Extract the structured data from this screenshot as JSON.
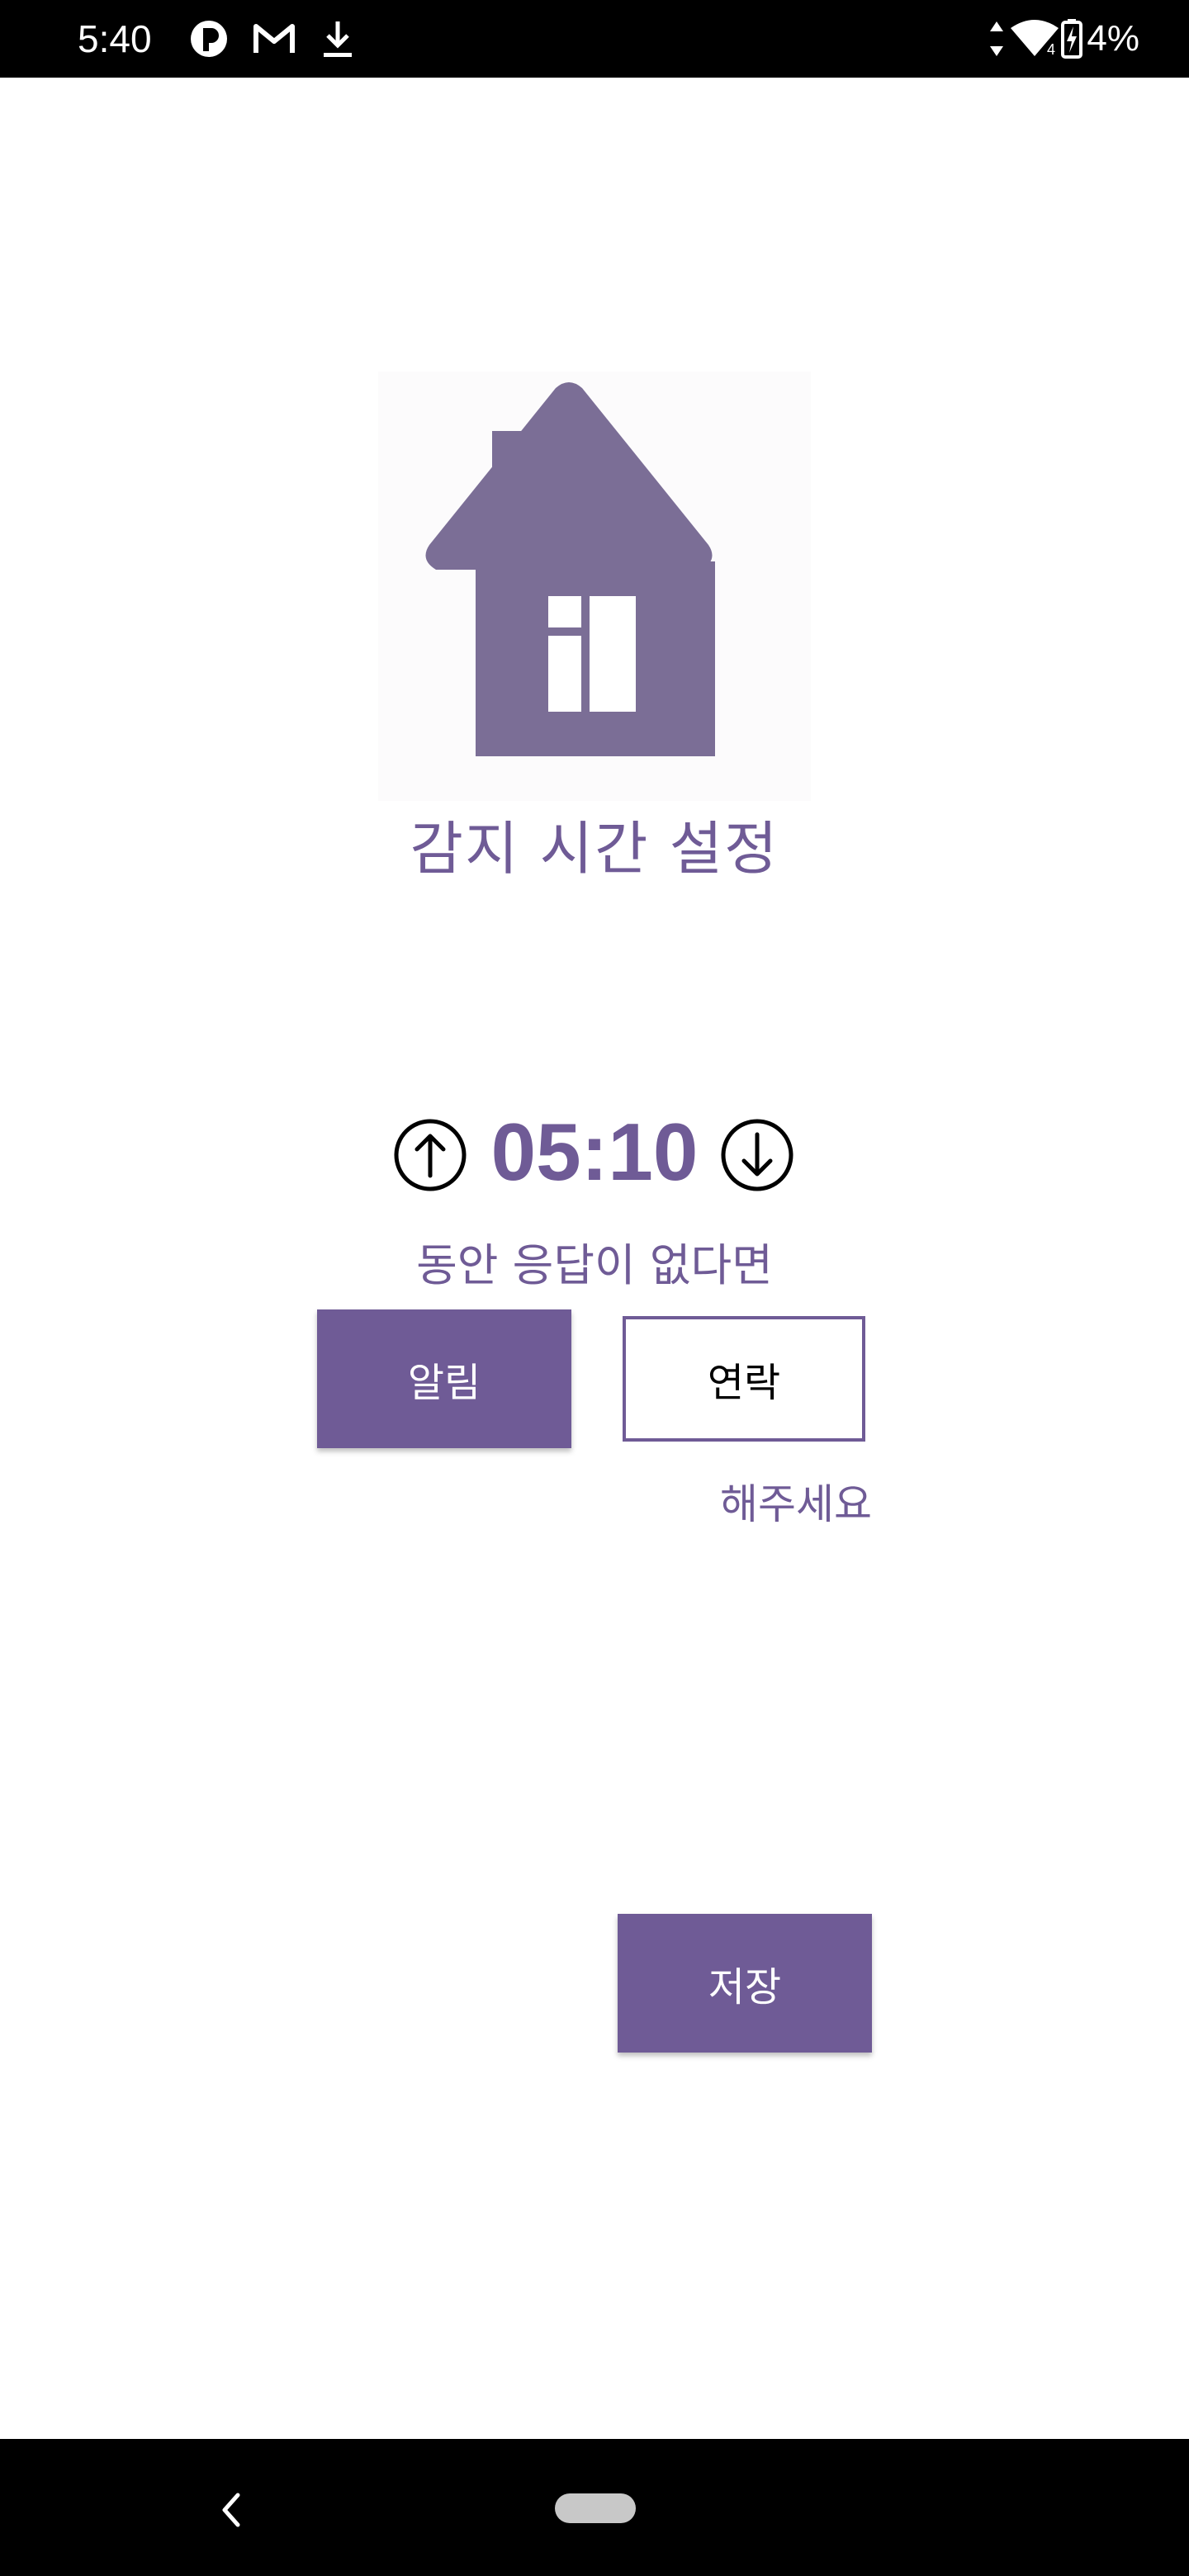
{
  "status_bar": {
    "time": "5:40",
    "battery": "4%",
    "icons": [
      "notification-app-icon",
      "gmail-icon",
      "download-icon",
      "data-arrows-icon",
      "wifi-icon",
      "battery-charging-icon"
    ]
  },
  "header": {
    "logo_icon": "house-icon",
    "title": "감지 시간 설정"
  },
  "timer": {
    "increase_icon": "arrow-up-icon",
    "value": "05:10",
    "decrease_icon": "arrow-down-icon",
    "caption": "동안 응답이 없다면"
  },
  "actions": {
    "alert_label": "알림",
    "contact_label": "연락",
    "suffix_text": "해주세요",
    "save_label": "저장"
  },
  "colors": {
    "accent": "#6f5b96",
    "house": "#7b6e96",
    "background": "#ffffff"
  },
  "nav_bar": {
    "icons": [
      "back-icon",
      "home-pill-icon"
    ]
  }
}
